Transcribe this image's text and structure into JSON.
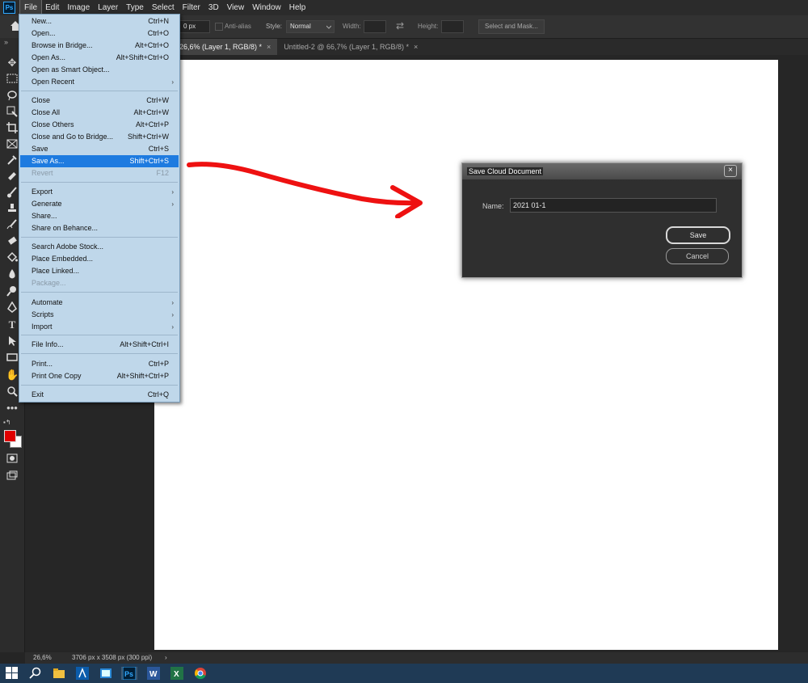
{
  "menubar": {
    "logo": "Ps",
    "items": [
      "File",
      "Edit",
      "Image",
      "Layer",
      "Type",
      "Select",
      "Filter",
      "3D",
      "View",
      "Window",
      "Help"
    ]
  },
  "options": {
    "feather_value": "0 px",
    "anti_alias": "Anti-alias",
    "style_label": "Style:",
    "style_value": "Normal",
    "width_label": "Width:",
    "height_label": "Height:",
    "select_mask": "Select and Mask..."
  },
  "tabs": [
    {
      "label": "26,6% (Layer 1, RGB/8) *"
    },
    {
      "label": "Untitled-2 @ 66,7% (Layer 1, RGB/8) *"
    }
  ],
  "tab_close": "×",
  "file_menu": {
    "items": [
      {
        "label": "New...",
        "shortcut": "Ctrl+N"
      },
      {
        "label": "Open...",
        "shortcut": "Ctrl+O"
      },
      {
        "label": "Browse in Bridge...",
        "shortcut": "Alt+Ctrl+O"
      },
      {
        "label": "Open As...",
        "shortcut": "Alt+Shift+Ctrl+O"
      },
      {
        "label": "Open as Smart Object...",
        "shortcut": ""
      },
      {
        "label": "Open Recent",
        "shortcut": ""
      },
      {
        "label": "Close",
        "shortcut": "Ctrl+W"
      },
      {
        "label": "Close All",
        "shortcut": "Alt+Ctrl+W"
      },
      {
        "label": "Close Others",
        "shortcut": "Alt+Ctrl+P"
      },
      {
        "label": "Close and Go to Bridge...",
        "shortcut": "Shift+Ctrl+W"
      },
      {
        "label": "Save",
        "shortcut": "Ctrl+S"
      },
      {
        "label": "Save As...",
        "shortcut": "Shift+Ctrl+S"
      },
      {
        "label": "Revert",
        "shortcut": "F12"
      },
      {
        "label": "Export",
        "shortcut": ""
      },
      {
        "label": "Generate",
        "shortcut": ""
      },
      {
        "label": "Share...",
        "shortcut": ""
      },
      {
        "label": "Share on Behance...",
        "shortcut": ""
      },
      {
        "label": "Search Adobe Stock...",
        "shortcut": ""
      },
      {
        "label": "Place Embedded...",
        "shortcut": ""
      },
      {
        "label": "Place Linked...",
        "shortcut": ""
      },
      {
        "label": "Package...",
        "shortcut": ""
      },
      {
        "label": "Automate",
        "shortcut": ""
      },
      {
        "label": "Scripts",
        "shortcut": ""
      },
      {
        "label": "Import",
        "shortcut": ""
      },
      {
        "label": "File Info...",
        "shortcut": "Alt+Shift+Ctrl+I"
      },
      {
        "label": "Print...",
        "shortcut": "Ctrl+P"
      },
      {
        "label": "Print One Copy",
        "shortcut": "Alt+Shift+Ctrl+P"
      },
      {
        "label": "Exit",
        "shortcut": "Ctrl+Q"
      }
    ],
    "submenu_arrow": "›"
  },
  "dialog": {
    "title": "Save Cloud Document",
    "close": "×",
    "name_label": "Name:",
    "name_value": "2021 01-1",
    "save_label": "Save",
    "cancel_label": "Cancel"
  },
  "status": {
    "zoom": "26,6%",
    "doc_info": "3706 px x 3508 px (300 ppi)",
    "arrow": "›"
  },
  "colors": {
    "foreground": "#e00000",
    "background": "#ffffff",
    "menu_bg": "#bfd7ea",
    "menu_highlight": "#1e7be0",
    "annotation_arrow": "#ee1111"
  }
}
